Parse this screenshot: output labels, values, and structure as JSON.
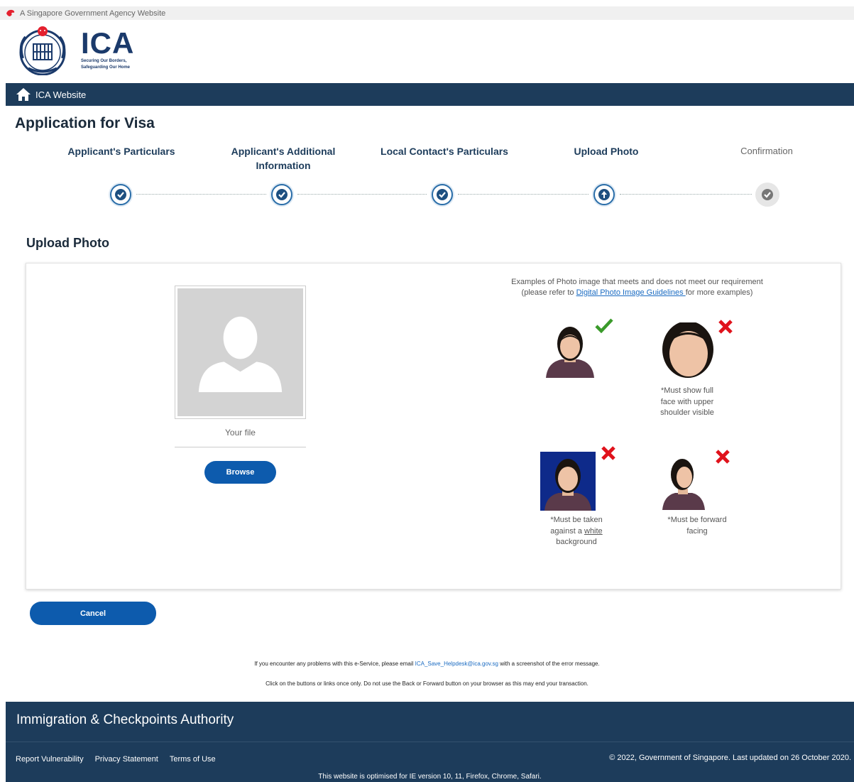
{
  "gov_bar": {
    "text": "A Singapore Government Agency Website"
  },
  "logo": {
    "name": "ICA",
    "tagline_line1": "Securing Our Borders,",
    "tagline_line2": "Safeguarding Our Home"
  },
  "nav": {
    "home_label": "ICA Website"
  },
  "page": {
    "title": "Application for Visa"
  },
  "steps": [
    {
      "label_line1": "Applicant's Particulars",
      "label_line2": "",
      "state": "done"
    },
    {
      "label_line1": "Applicant's Additional",
      "label_line2": "Information",
      "state": "done"
    },
    {
      "label_line1": "Local Contact's Particulars",
      "label_line2": "",
      "state": "done"
    },
    {
      "label_line1": "Upload Photo",
      "label_line2": "",
      "state": "current"
    },
    {
      "label_line1": "Confirmation",
      "label_line2": "",
      "state": "pending"
    }
  ],
  "section": {
    "title": "Upload Photo"
  },
  "upload": {
    "file_label": "Your file",
    "browse_label": "Browse"
  },
  "examples": {
    "intro_line1": "Examples of Photo image that meets and does not meet our requirement",
    "intro_prefix": "(please refer to ",
    "intro_link": "Digital Photo Image Guidelines ",
    "intro_suffix": "for more examples)",
    "items": [
      {
        "status": "ok",
        "caption": []
      },
      {
        "status": "bad",
        "caption": [
          "*Must show full",
          "face with upper",
          "shoulder visible"
        ]
      },
      {
        "status": "bad",
        "caption": [
          "*Must be taken",
          "against a ",
          "white",
          "background"
        ]
      },
      {
        "status": "bad",
        "caption": [
          "*Must be forward",
          "facing"
        ]
      }
    ]
  },
  "actions": {
    "cancel_label": "Cancel"
  },
  "notes": {
    "problem_prefix": "If you encounter any problems with this e-Service, please email ",
    "problem_email": "ICA_Save_Helpdesk@ica.gov.sg",
    "problem_suffix": " with a screenshot of the error message.",
    "click_once": "Click on the buttons or links once only. Do not use the Back or Forward button on your browser as this may end your transaction."
  },
  "footer": {
    "title": "Immigration & Checkpoints Authority",
    "links": [
      "Report Vulnerability",
      "Privacy Statement",
      "Terms of Use"
    ],
    "copyright": "© 2022, Government of Singapore. Last updated on 26 October 2020.",
    "optimised": "This website is optimised for IE version 10, 11, Firefox, Chrome, Safari."
  },
  "colors": {
    "navy": "#1d3c5b",
    "button_blue": "#0d5bad",
    "check_green": "#3a9a2a",
    "cross_red": "#e0121b",
    "step_blue": "#2a6da8"
  },
  "icons": [
    "lion-head-icon",
    "ica-crest-logo",
    "home-icon",
    "step-check-icon",
    "step-upload-icon",
    "avatar-placeholder-icon",
    "check-mark-icon",
    "cross-mark-icon"
  ]
}
